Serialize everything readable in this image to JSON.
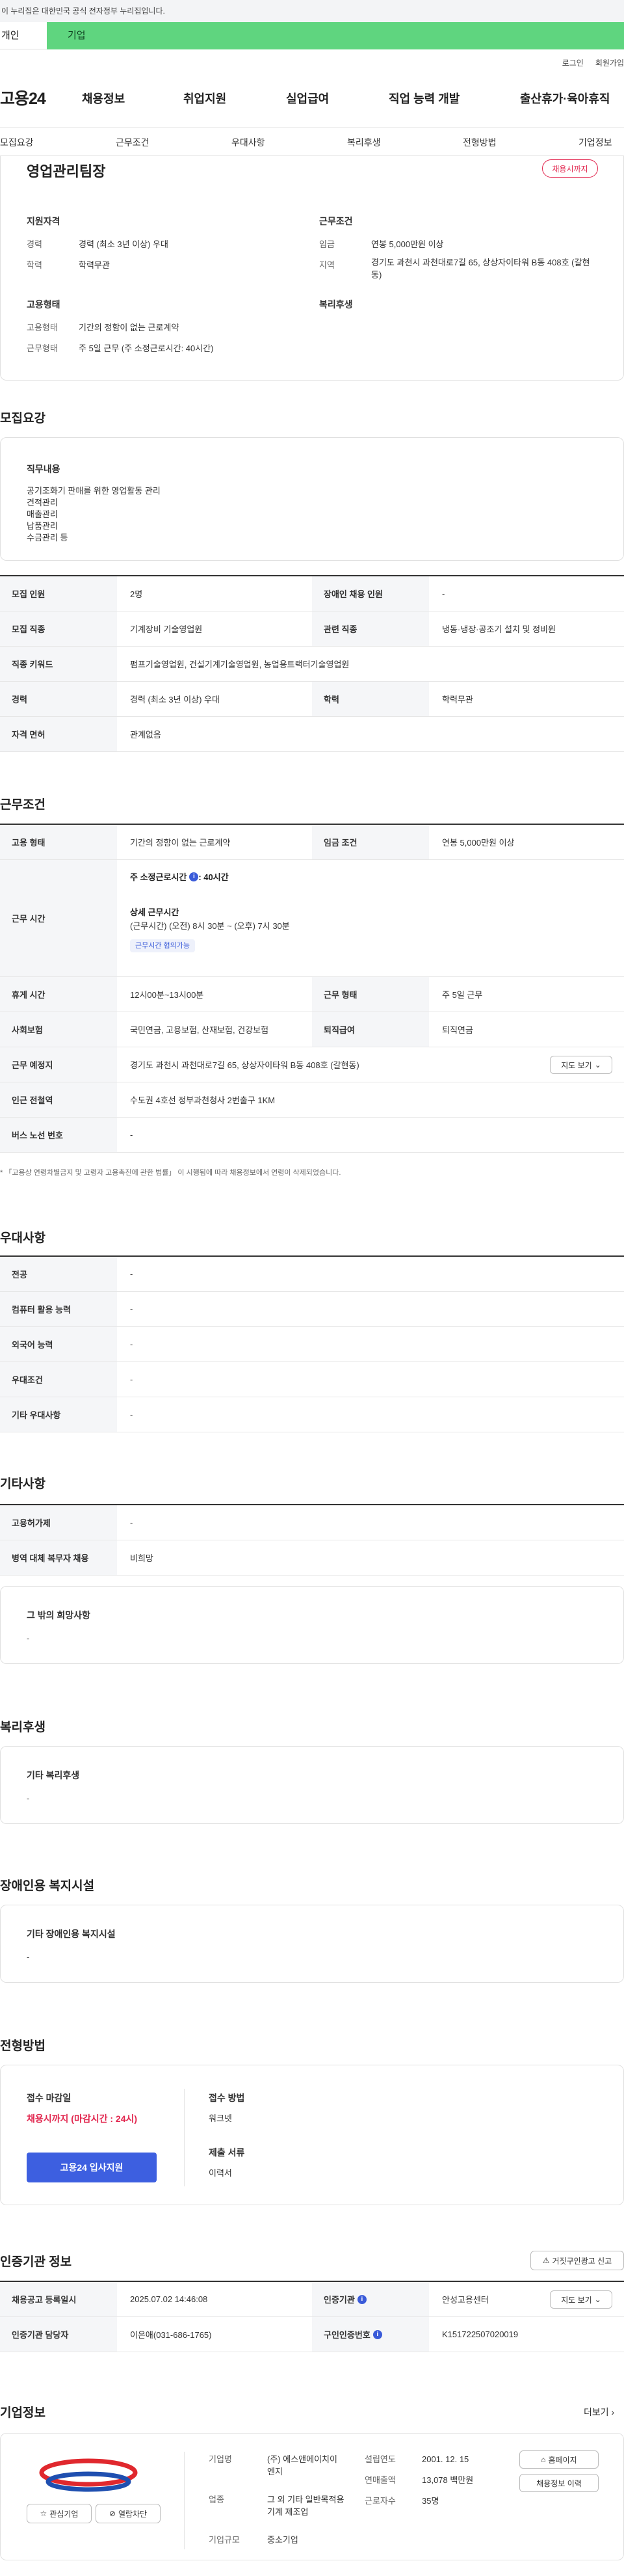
{
  "banner": {
    "text": "이 누리집은 대한민국 공식 전자정부 누리집입니다."
  },
  "top_tabs": {
    "left": "개인",
    "right": "기업"
  },
  "util": {
    "login": "로그인",
    "join": "회원가입"
  },
  "gnb": {
    "logo": "고용24",
    "items": [
      "채용정보",
      "취업지원",
      "실업급여",
      "직업 능력 개발",
      "출산휴가·육아휴직"
    ]
  },
  "subnav": [
    "모집요강",
    "근무조건",
    "우대사항",
    "복리후생",
    "전형방법",
    "기업정보"
  ],
  "summary": {
    "title": "영업관리팀장",
    "badge": "채용시까지",
    "qual_title": "지원자격",
    "qual": [
      {
        "label": "경력",
        "value": "경력 (최소 3년 이상) 우대"
      },
      {
        "label": "학력",
        "value": "학력무관"
      }
    ],
    "work_title": "근무조건",
    "work": [
      {
        "label": "임금",
        "value": "연봉 5,000만원 이상"
      },
      {
        "label": "지역",
        "value": "경기도 과천시 과천대로7길 65, 상상자이타워 B동 408호 (갈현동)"
      }
    ],
    "emp_title": "고용형태",
    "emp": [
      {
        "label": "고용형태",
        "value": "기간의 정함이 없는 근로계약"
      },
      {
        "label": "근무형태",
        "value": "주 5일 근무 (주 소정근로시간: 40시간)"
      }
    ],
    "welfare_title": "복리후생"
  },
  "recruit": {
    "section_title": "모집요강",
    "duty_title": "직무내용",
    "duty_lines": [
      "공기조화기 판매를 위한 영업활동 관리",
      "견적관리",
      "매출관리",
      "납품관리",
      "수금관리 등"
    ],
    "rows": [
      {
        "th1": "모집 인원",
        "td1": "2명",
        "th2": "장애인 채용 인원",
        "td2": "-"
      },
      {
        "th1": "모집 직종",
        "td1": "기계장비 기술영업원",
        "th2": "관련 직종",
        "td2": "냉동·냉장·공조기 설치 및 정비원"
      },
      {
        "th1": "직종 키워드",
        "td1": "펌프기술영업원, 건설기계기술영업원, 농업용트랙터기술영업원"
      },
      {
        "th1": "경력",
        "td1": "경력 (최소 3년 이상) 우대",
        "th2": "학력",
        "td2": "학력무관"
      },
      {
        "th1": "자격 면허",
        "td1": "관계없음"
      }
    ]
  },
  "work_cond": {
    "section_title": "근무조건",
    "rows1": {
      "th1": "고용 형태",
      "td1": "기간의 정함이 없는 근로계약",
      "th2": "임금 조건",
      "td2": "연봉 5,000만원 이상"
    },
    "hours": {
      "th": "근무 시간",
      "weekly_label": "주 소정근로시간",
      "weekly_value": ": 40시간",
      "detail_title": "상세 근무시간",
      "detail_value": "(근무시간) (오전) 8시 30분 ~ (오후) 7시 30분",
      "chip": "근무시간 협의가능"
    },
    "rows": [
      {
        "th1": "휴게 시간",
        "td1": "12시00분~13시00분",
        "th2": "근무 형태",
        "td2": "주 5일 근무"
      },
      {
        "th1": "사회보험",
        "td1": "국민연금, 고용보험, 산재보험, 건강보험",
        "th2": "퇴직급여",
        "td2": "퇴직연금"
      }
    ],
    "location": {
      "th": "근무 예정지",
      "td": "경기도 과천시 과천대로7길 65, 상상자이타워 B동 408호 (갈현동)",
      "btn": "지도 보기"
    },
    "subway": {
      "th": "인근 전철역",
      "td": "수도권 4호선 정부과천청사 2번출구 1KM"
    },
    "bus": {
      "th": "버스 노선 번호",
      "td": "-"
    },
    "note": "* 「고용상 연령차별금지 및 고령자 고용촉진에 관한 법률」 이 시행됨에 따라 채용정보에서 연령이 삭제되었습니다."
  },
  "prefer": {
    "section_title": "우대사항",
    "rows": [
      {
        "th": "전공",
        "td": "-"
      },
      {
        "th": "컴퓨터 활용 능력",
        "td": "-"
      },
      {
        "th": "외국어 능력",
        "td": "-"
      },
      {
        "th": "우대조건",
        "td": "-"
      },
      {
        "th": "기타 우대사항",
        "td": "-"
      }
    ]
  },
  "etc": {
    "section_title": "기타사항",
    "rows": [
      {
        "th": "고용허가제",
        "td": "-"
      },
      {
        "th": "병역 대체 복무자 채용",
        "td": "비희망"
      }
    ],
    "extra_title": "그 밖의 희망사항",
    "extra_value": "-"
  },
  "welfare": {
    "section_title": "복리후생",
    "card_title": "기타 복리후생",
    "card_value": "-"
  },
  "disabled": {
    "section_title": "장애인용 복지시설",
    "card_title": "기타 장애인용 복지시설",
    "card_value": "-"
  },
  "screening": {
    "section_title": "전형방법",
    "deadline_title": "접수 마감일",
    "deadline_value": "채용시까지 (마감시간 : 24시)",
    "apply_btn": "고용24 입사지원",
    "method_title": "접수 방법",
    "method_value": "워크넷",
    "docs_title": "제출 서류",
    "docs_value": "이력서"
  },
  "agency": {
    "section_title": "인증기관 정보",
    "report_btn": "거짓구인광고 신고",
    "rows": [
      {
        "th1": "채용공고 등록일시",
        "td1": "2025.07.02 14:46:08",
        "th2": "인증기관",
        "td2": "안성고용센터",
        "btn": "지도 보기"
      },
      {
        "th1": "인증기관 담당자",
        "td1": "이은애(031-686-1765)",
        "th2": "구인인증번호",
        "td2": "K151722507020019"
      }
    ]
  },
  "company": {
    "section_title": "기업정보",
    "more": "더보기",
    "fav_btn": "관심기업",
    "block_btn": "열람차단",
    "fields": [
      {
        "label": "기업명",
        "value": "(주) 에스앤에이치이엔지"
      },
      {
        "label": "업종",
        "value": "그 외 기타 일반목적용 기계 제조업"
      },
      {
        "label": "기업규모",
        "value": "중소기업"
      }
    ],
    "fields2": [
      {
        "label": "설립연도",
        "value": "2001. 12. 15"
      },
      {
        "label": "연매출액",
        "value": "13,078 백만원"
      },
      {
        "label": "근로자수",
        "value": "35명"
      }
    ],
    "homepage_btn": "홈페이지",
    "history_btn": "채용정보 이력"
  }
}
